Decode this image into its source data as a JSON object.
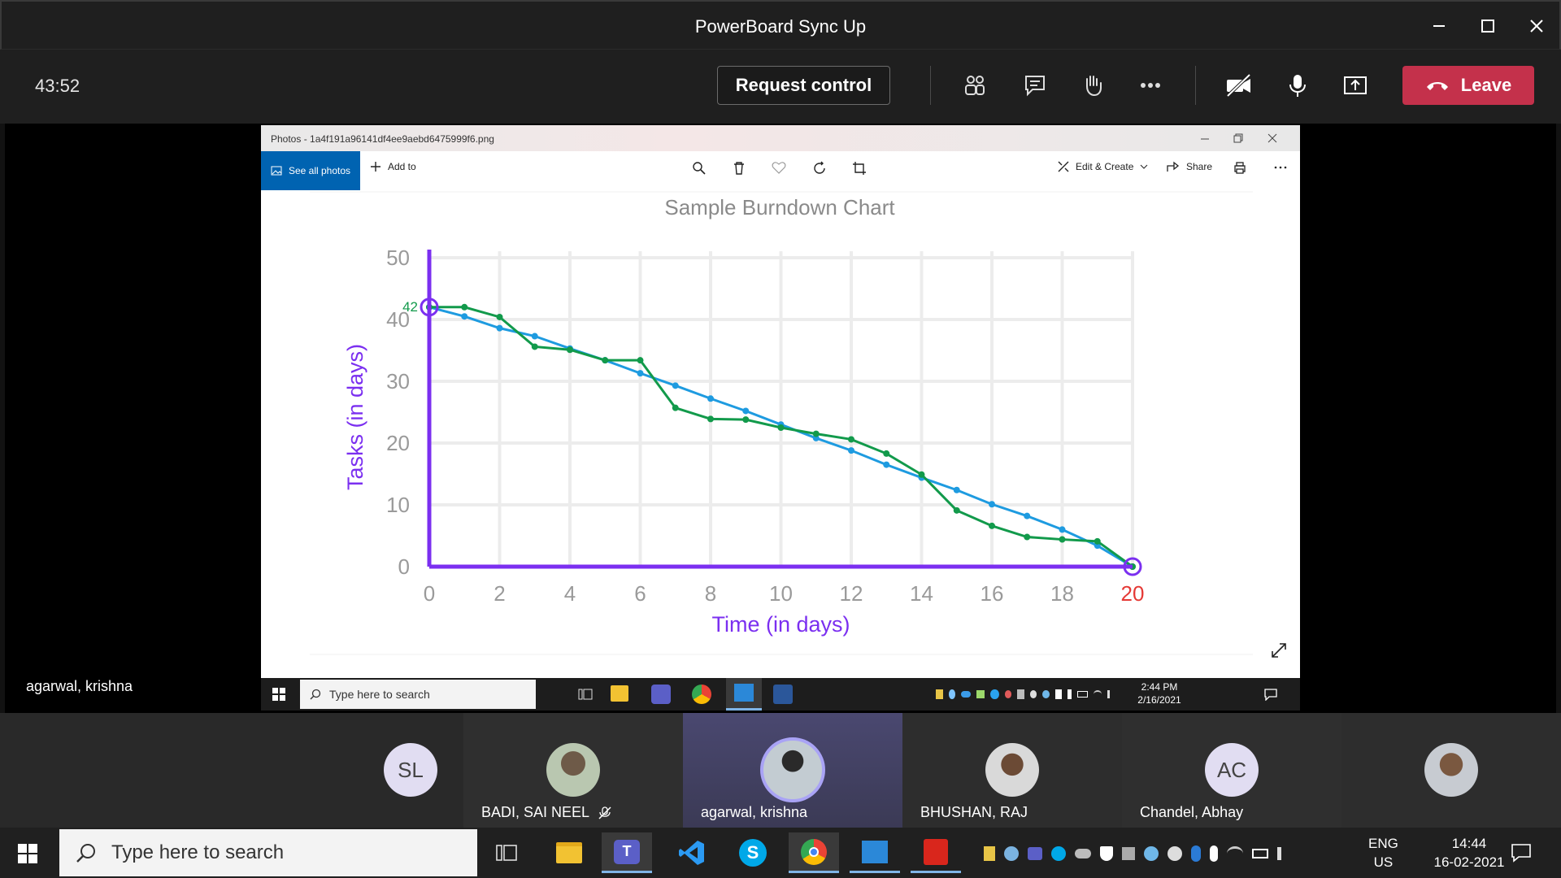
{
  "window": {
    "title": "PowerBoard Sync Up"
  },
  "meeting": {
    "timer": "43:52",
    "request_control": "Request control",
    "leave": "Leave",
    "presenter_name": "agarwal, krishna"
  },
  "photos_app": {
    "file_title": "Photos - 1a4f191a96141df4ee9aebd6475999f6.png",
    "see_all": "See all photos",
    "add_to": "Add to",
    "edit_create": "Edit & Create",
    "share": "Share"
  },
  "chart_data": {
    "type": "line",
    "title": "Sample Burndown Chart",
    "xlabel": "Time (in days)",
    "ylabel": "Tasks (in days)",
    "x_ticks": [
      "0",
      "2",
      "4",
      "6",
      "8",
      "10",
      "12",
      "14",
      "16",
      "18",
      "20"
    ],
    "y_ticks": [
      "0",
      "10",
      "20",
      "30",
      "40",
      "50"
    ],
    "xlim": [
      0,
      20
    ],
    "ylim": [
      0,
      50
    ],
    "grid": true,
    "annotations": [
      {
        "x": 0,
        "y": 42,
        "text": "42"
      }
    ],
    "series": [
      {
        "color": "#1e9be0",
        "x": [
          0,
          1,
          2,
          3,
          4,
          5,
          6,
          7,
          8,
          9,
          10,
          11,
          12,
          13,
          14,
          15,
          16,
          17,
          18,
          19,
          20
        ],
        "y": [
          42,
          40.5,
          38.6,
          37.3,
          35.3,
          33.4,
          31.3,
          29.3,
          27.2,
          25.2,
          23,
          20.8,
          18.8,
          16.5,
          14.4,
          12.4,
          10.1,
          8.2,
          6,
          3.4,
          0
        ]
      },
      {
        "color": "#129a4b",
        "x": [
          0,
          1,
          2,
          3,
          4,
          5,
          6,
          7,
          8,
          9,
          10,
          11,
          12,
          13,
          14,
          15,
          16,
          17,
          18,
          19,
          20
        ],
        "y": [
          42,
          42,
          40.4,
          35.6,
          35.1,
          33.4,
          33.4,
          25.7,
          23.9,
          23.8,
          22.5,
          21.5,
          20.6,
          18.3,
          14.9,
          9.1,
          6.6,
          4.8,
          4.4,
          4.1,
          0
        ]
      }
    ],
    "colors": {
      "axis": "#7b2ff0",
      "grid": "#ececec",
      "tick": "#9a9a9a",
      "end_tick": "#e53935",
      "annotation": "#129a4b",
      "title": "#8a8a8a"
    }
  },
  "inner_taskbar": {
    "search_placeholder": "Type here to search",
    "time": "2:44 PM",
    "date": "2/16/2021"
  },
  "participants": [
    {
      "initials": "SL",
      "name": "",
      "avatar_color": "#e1ddf2"
    },
    {
      "initials": "",
      "name": "BADI, SAI NEEL",
      "muted": true,
      "avatar_color": "#c9d4c0"
    },
    {
      "initials": "",
      "name": "agarwal, krishna",
      "speaking": true,
      "avatar_color": "#b8c4cc"
    },
    {
      "initials": "",
      "name": "BHUSHAN, RAJ",
      "avatar_color": "#d8d8d8"
    },
    {
      "initials": "AC",
      "name": "Chandel, Abhay",
      "avatar_color": "#e1ddf2"
    },
    {
      "initials": "",
      "name": "",
      "avatar_color": "#c7cbd1"
    }
  ],
  "taskbar": {
    "search_placeholder": "Type here to search",
    "lang": "ENG",
    "region": "US",
    "time": "14:44",
    "date": "16-02-2021"
  }
}
